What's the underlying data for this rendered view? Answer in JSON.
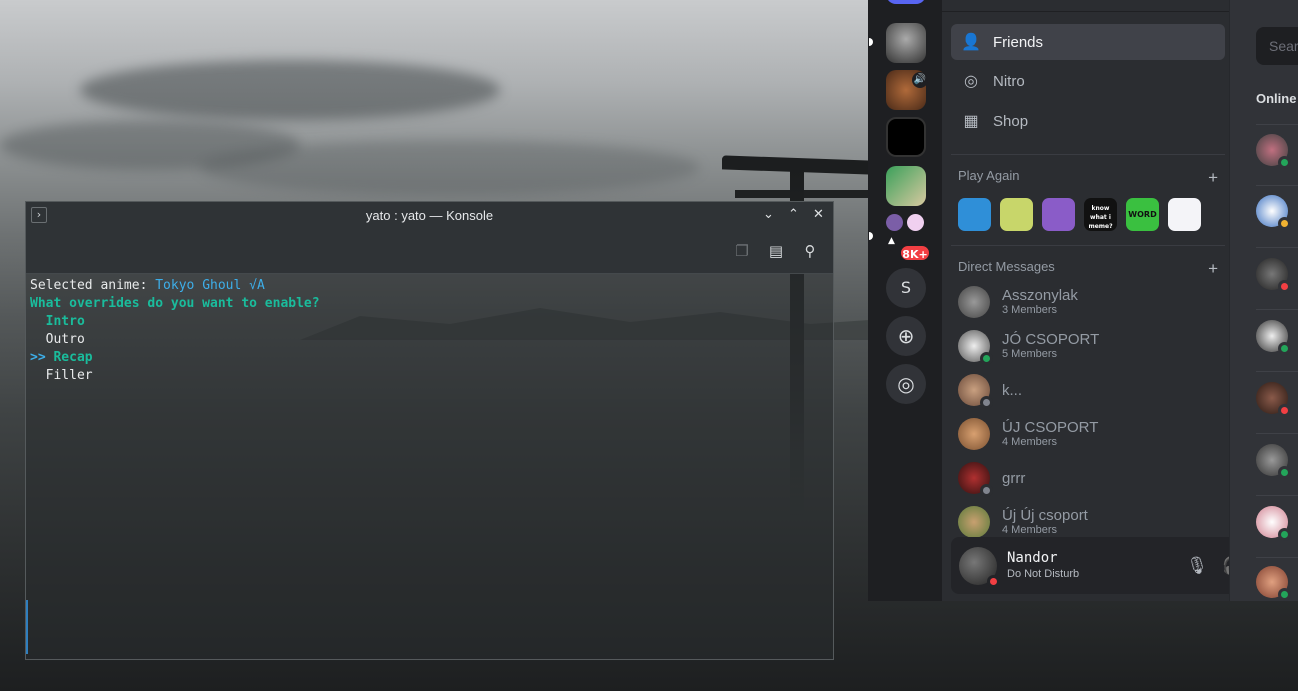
{
  "konsole": {
    "title": "yato : yato — Konsole",
    "lines": {
      "selected_prefix": "Selected anime: ",
      "selected_value": "Tokyo Ghoul √A",
      "question": "What overrides do you want to enable?",
      "opt1": "  Intro",
      "opt2": "  Outro",
      "opt3_arrow": ">> ",
      "opt3_label": "Recap",
      "opt4": "  Filler"
    }
  },
  "discord": {
    "nav": {
      "friends": "Friends",
      "nitro": "Nitro",
      "shop": "Shop"
    },
    "servers": {
      "badge": "8K+",
      "letter": "S"
    },
    "play_again": {
      "label": "Play Again",
      "games": [
        "",
        "",
        "",
        "know what i meme?",
        "WORD 10",
        ""
      ]
    },
    "direct_messages": {
      "label": "Direct Messages",
      "items": [
        {
          "name": "Asszonylak",
          "sub": "3 Members"
        },
        {
          "name": "JÓ CSOPORT",
          "sub": "5 Members"
        },
        {
          "name": "k...",
          "sub": ""
        },
        {
          "name": "ÚJ CSOPORT",
          "sub": "4 Members"
        },
        {
          "name": "grrr",
          "sub": ""
        },
        {
          "name": "Új Új csoport",
          "sub": "4 Members"
        }
      ]
    },
    "user": {
      "name": "Nandor",
      "status": "Do Not Disturb"
    },
    "right": {
      "search_placeholder": "Sear",
      "online_label": "Online"
    }
  }
}
